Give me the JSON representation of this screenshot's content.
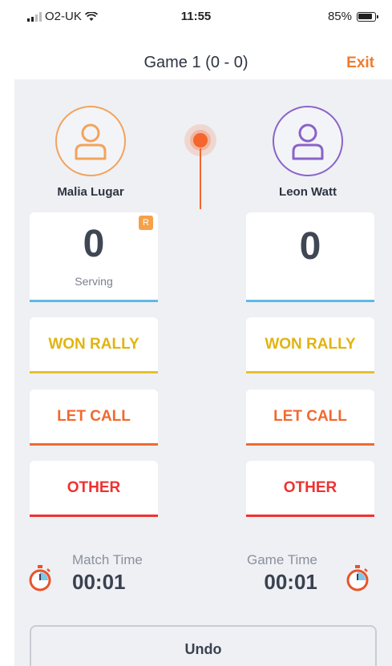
{
  "status_bar": {
    "carrier": "O2-UK",
    "time": "11:55",
    "battery": "85%"
  },
  "nav": {
    "title": "Game 1 (0 - 0)",
    "exit_label": "Exit"
  },
  "players": {
    "left": {
      "name": "Malia Lugar",
      "score": "0",
      "status": "Serving",
      "badge": "R",
      "color": "#f3a35b"
    },
    "right": {
      "name": "Leon Watt",
      "score": "0",
      "color": "#8a63c9"
    }
  },
  "actions": {
    "won_rally": "WON RALLY",
    "let_call": "LET CALL",
    "other": "OTHER"
  },
  "timers": {
    "match": {
      "label": "Match Time",
      "value": "00:01"
    },
    "game": {
      "label": "Game Time",
      "value": "00:01"
    }
  },
  "undo_label": "Undo",
  "colors": {
    "accent": "#f07b2c",
    "won": "#e1b40f",
    "let": "#f06a2f",
    "other": "#ef3131",
    "score_line": "#5fb8e6"
  }
}
